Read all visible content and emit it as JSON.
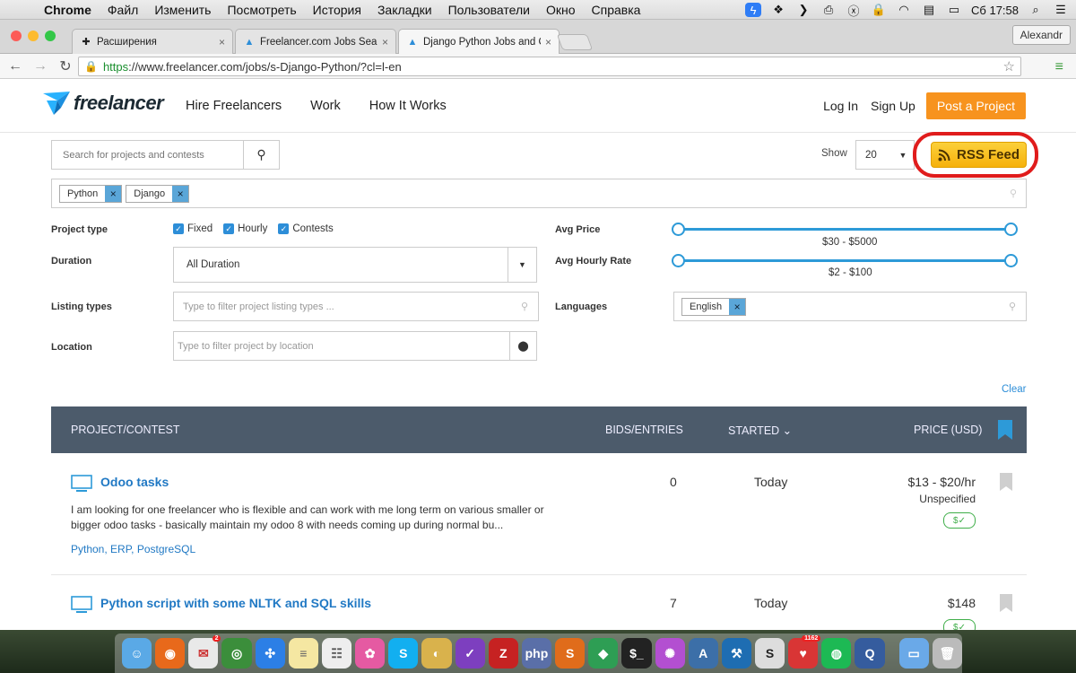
{
  "menubar": {
    "app": "Chrome",
    "items": [
      "Файл",
      "Изменить",
      "Посмотреть",
      "История",
      "Закладки",
      "Пользователи",
      "Окно",
      "Справка"
    ],
    "clock": "Сб 17:58"
  },
  "tabs": [
    {
      "label": "Расширения",
      "icon": "puzzle-icon"
    },
    {
      "label": "Freelancer.com Jobs Searc",
      "icon": "freelancer-favicon"
    },
    {
      "label": "Django Python Jobs and C",
      "icon": "freelancer-favicon"
    }
  ],
  "profile": "Alexandr",
  "address": {
    "scheme": "https",
    "rest": "://www.freelancer.com/jobs/s-Django-Python/?cl=l-en"
  },
  "header": {
    "logo_text": "freelancer",
    "nav": [
      "Hire Freelancers",
      "Work",
      "How It Works"
    ],
    "login": "Log In",
    "signup": "Sign Up",
    "post": "Post a Project"
  },
  "search": {
    "placeholder": "Search for projects and contests"
  },
  "show": {
    "label": "Show",
    "value": "20"
  },
  "rss": {
    "label": "RSS Feed"
  },
  "tags": [
    "Python",
    "Django"
  ],
  "filters": {
    "project_type_label": "Project type",
    "types": [
      "Fixed",
      "Hourly",
      "Contests"
    ],
    "duration_label": "Duration",
    "duration_value": "All Duration",
    "listing_label": "Listing types",
    "listing_placeholder": "Type to filter project listing types ...",
    "location_label": "Location",
    "location_placeholder": "Type to filter project by location",
    "avg_price_label": "Avg Price",
    "avg_price_range": "$30 - $5000",
    "avg_hourly_label": "Avg Hourly Rate",
    "avg_hourly_range": "$2 - $100",
    "languages_label": "Languages",
    "language_tag": "English",
    "clear": "Clear"
  },
  "table": {
    "headers": {
      "project": "PROJECT/CONTEST",
      "bids": "BIDS/ENTRIES",
      "started": "STARTED",
      "price": "PRICE (USD)"
    },
    "rows": [
      {
        "title": "Odoo tasks",
        "desc1": "I am looking for one freelancer who is flexible and can work with me long term on various smaller or",
        "desc2": "bigger odoo tasks - basically maintain my odoo 8 with needs coming up during normal bu...",
        "skills": "Python, ERP, PostgreSQL",
        "bids": "0",
        "started": "Today",
        "price": "$13 - $20/hr",
        "sub": "Unspecified"
      },
      {
        "title": "Python script with some NLTK and SQL skills",
        "bids": "7",
        "started": "Today",
        "price": "$148"
      }
    ]
  },
  "colors": {
    "accent_blue": "#2d8ed8",
    "orange": "#f7931e",
    "header_dark": "#4c5b6b",
    "highlight_red": "#e01c1c"
  }
}
